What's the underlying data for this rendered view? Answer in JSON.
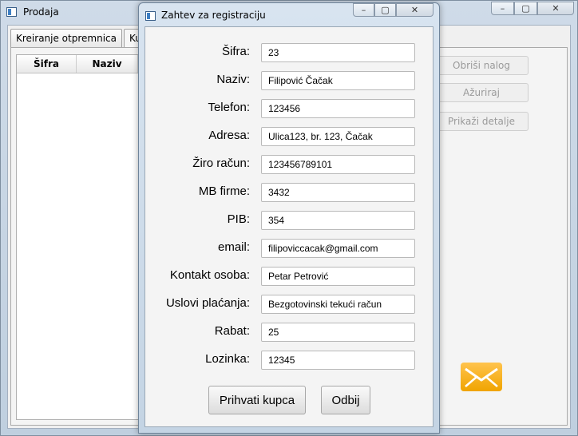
{
  "main_window": {
    "title": "Prodaja",
    "controls": {
      "minimize": "–",
      "maximize": "▢",
      "close": "✕"
    },
    "tabs": [
      {
        "label": "Kreiranje otpremnica"
      },
      {
        "label": "Kupci"
      }
    ],
    "table_headers": [
      "Šifra",
      "Naziv"
    ],
    "buttons": {
      "delete": "Obriši nalog",
      "update": "Ažuriraj",
      "details": "Prikaži detalje"
    },
    "mail_icon": "envelope-icon"
  },
  "dialog": {
    "title": "Zahtev za registraciju",
    "controls": {
      "minimize": "–",
      "maximize": "▢",
      "close": "✕"
    },
    "fields": [
      {
        "label": "Šifra:",
        "value": "23"
      },
      {
        "label": "Naziv:",
        "value": "Filipović Čačak"
      },
      {
        "label": "Telefon:",
        "value": "123456"
      },
      {
        "label": "Adresa:",
        "value": "Ulica123, br. 123, Čačak"
      },
      {
        "label": "Žiro račun:",
        "value": "123456789101"
      },
      {
        "label": "MB firme:",
        "value": "3432"
      },
      {
        "label": "PIB:",
        "value": "354"
      },
      {
        "label": "email:",
        "value": "filipoviccacak@gmail.com"
      },
      {
        "label": "Kontakt osoba:",
        "value": "Petar Petrović"
      },
      {
        "label": "Uslovi plaćanja:",
        "value": "Bezgotovinski tekući račun"
      },
      {
        "label": "Rabat:",
        "value": "25"
      },
      {
        "label": "Lozinka:",
        "value": "12345"
      }
    ],
    "buttons": {
      "accept": "Prihvati kupca",
      "reject": "Odbij"
    }
  },
  "colors": {
    "accent_mail": "#f5a800",
    "window_frame": "#c4d4e4"
  }
}
